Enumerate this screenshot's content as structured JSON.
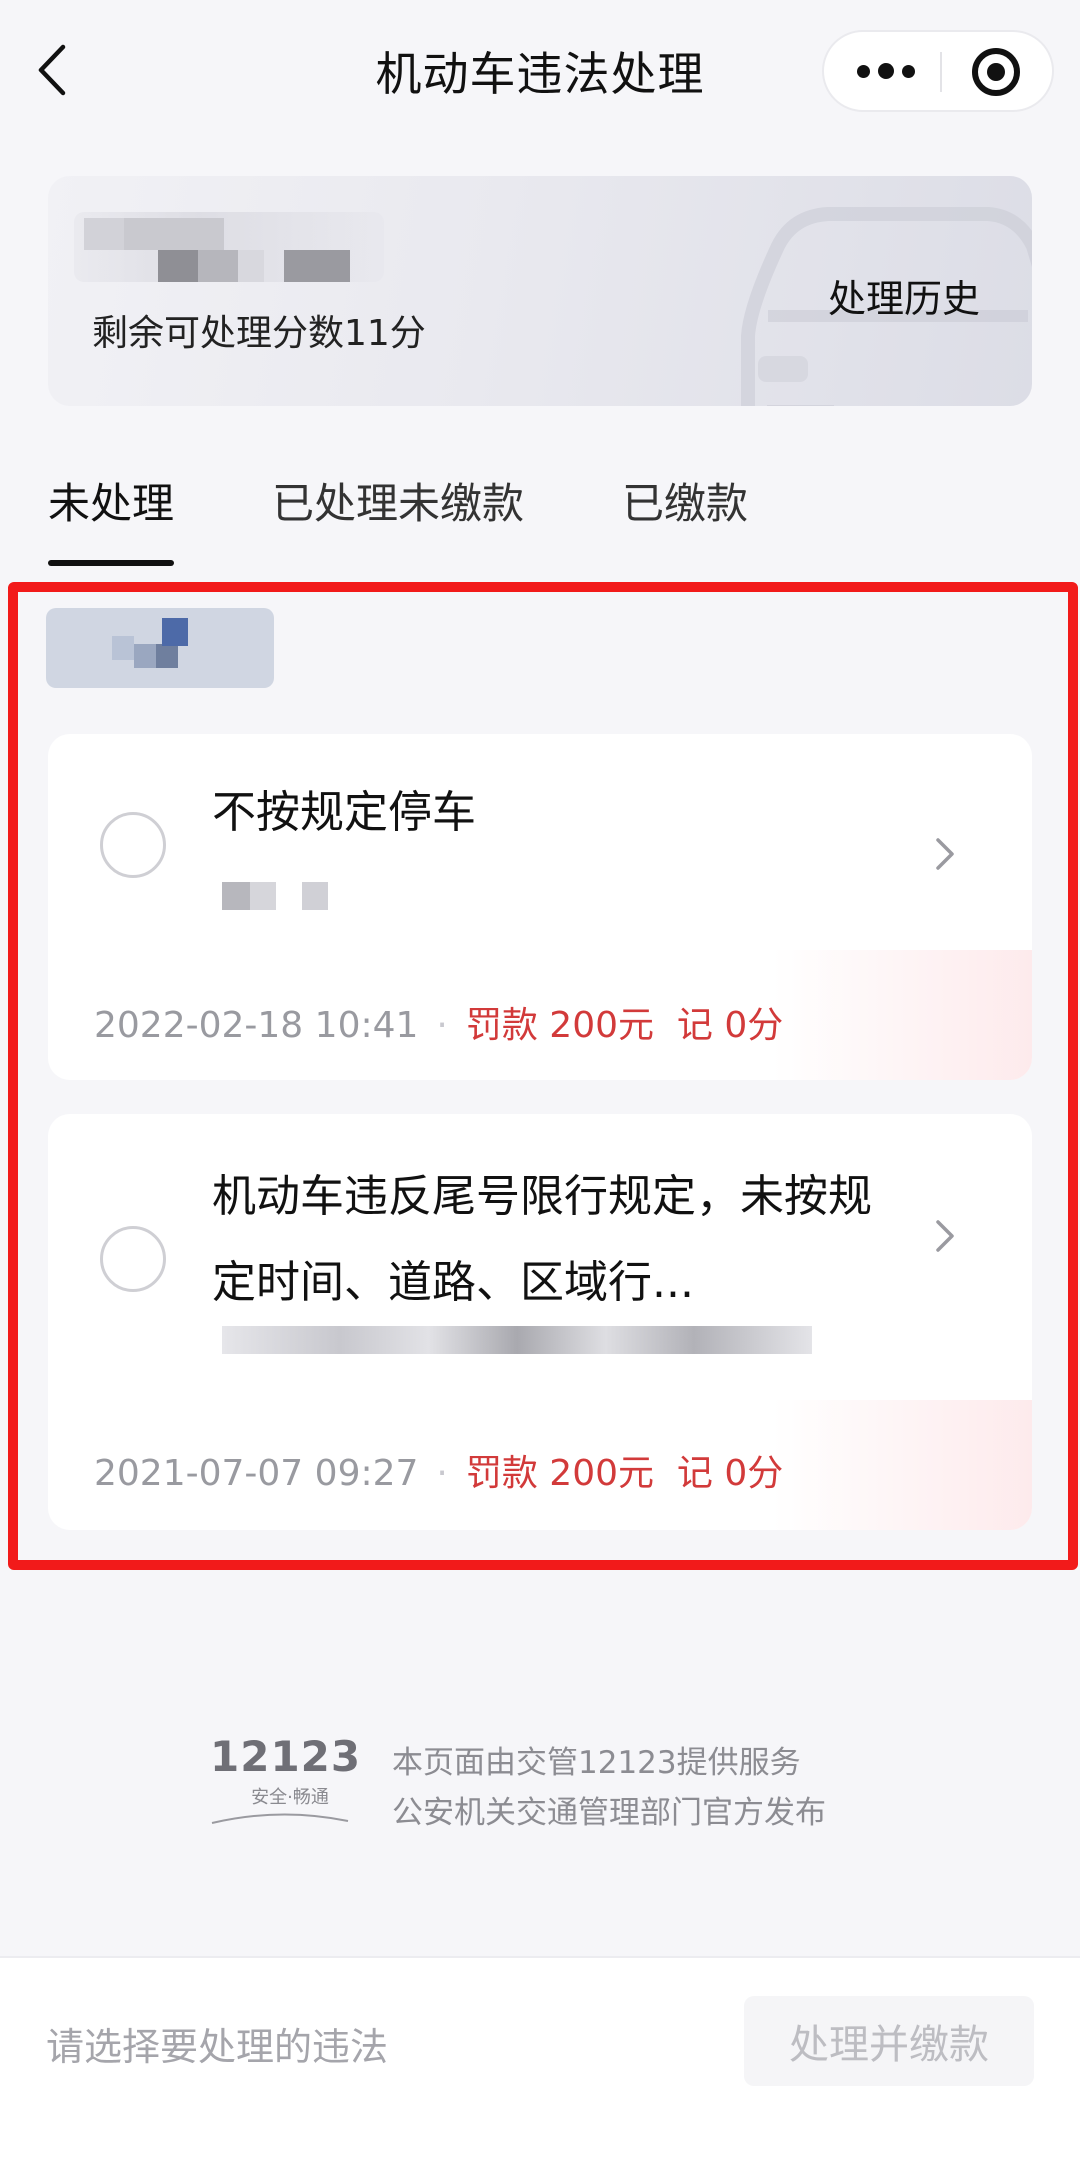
{
  "nav": {
    "title": "机动车违法处理"
  },
  "info_card": {
    "points_text": "剩余可处理分数11分",
    "history_label": "处理历史"
  },
  "tabs": [
    {
      "label": "未处理",
      "active": true
    },
    {
      "label": "已处理未缴款",
      "active": false
    },
    {
      "label": "已缴款",
      "active": false
    }
  ],
  "violations": [
    {
      "title": "不按规定停车",
      "time": "2022-02-18 10:41",
      "fine": "罚款 200元",
      "points": "记 0分",
      "selected": false
    },
    {
      "title": "机动车违反尾号限行规定，未按规定时间、道路、区域行...",
      "time": "2021-07-07 09:27",
      "fine": "罚款 200元",
      "points": "记 0分",
      "selected": false
    }
  ],
  "footer": {
    "logo_number": "12123",
    "logo_slogan": "安全·畅通",
    "line1": "本页面由交管12123提供服务",
    "line2": "公安机关交通管理部门官方发布"
  },
  "bottom": {
    "hint": "请选择要处理的违法",
    "submit_label": "处理并缴款"
  },
  "colors": {
    "accent_red": "#d23a3a",
    "highlight_red": "#f21a1a"
  }
}
